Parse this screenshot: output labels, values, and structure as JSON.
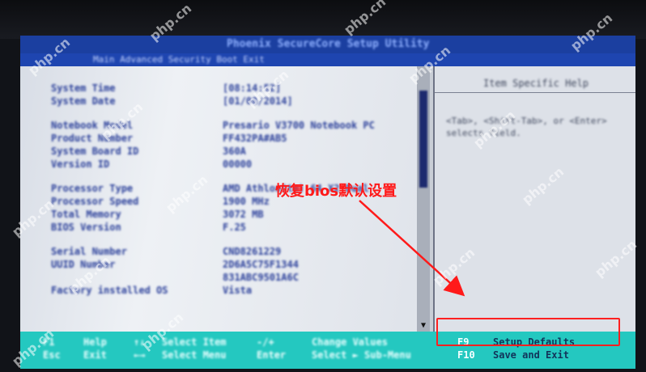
{
  "bios": {
    "title": "Phoenix SecureCore Setup Utility",
    "menu": "Main   Advanced   Security   Boot   Exit",
    "rows": [
      {
        "label": "System Time",
        "value": "[08:14:52]"
      },
      {
        "label": "System Date",
        "value": "[01/08/2014]"
      },
      {
        "label": "",
        "value": ""
      },
      {
        "label": "Notebook Model",
        "value": "Presario V3700 Notebook PC"
      },
      {
        "label": "Product Number",
        "value": "FF432PA#AB5"
      },
      {
        "label": "System Board ID",
        "value": "360A"
      },
      {
        "label": "Version ID",
        "value": "00000"
      },
      {
        "label": "",
        "value": ""
      },
      {
        "label": "Processor Type",
        "value": "AMD Athlon(tm) 64 X2 Dual"
      },
      {
        "label": "Processor Speed",
        "value": "1900 MHz"
      },
      {
        "label": "Total Memory",
        "value": "3072 MB"
      },
      {
        "label": "BIOS Version",
        "value": "F.25"
      },
      {
        "label": "",
        "value": ""
      },
      {
        "label": "Serial Number",
        "value": "CND8261229"
      },
      {
        "label": "UUID Number",
        "value": "2D6A5C75F1344"
      },
      {
        "label": "",
        "value": "831ABC9501A6C"
      },
      {
        "label": "Factory installed OS",
        "value": "Vista"
      }
    ],
    "help_title": "Item Specific Help",
    "help_text": "<Tab>, <Shift-Tab>, or <Enter> selects field.",
    "footer": {
      "row1": {
        "k1": "F1",
        "d1": "Help",
        "k2": "↑↓",
        "d2": "Select Item",
        "k3": "-/+",
        "d3": "Change Values",
        "k4": "F9",
        "d4": "Setup Defaults"
      },
      "row2": {
        "k1": "Esc",
        "d1": "Exit",
        "k2": "←→",
        "d2": "Select Menu",
        "k3": "Enter",
        "d3": "Select ► Sub-Menu",
        "k4": "F10",
        "d4": "Save and Exit"
      }
    },
    "scroll_arrow": "▼"
  },
  "annotation": {
    "text": "恢复bios默认设置",
    "color": "#ff1a1a"
  },
  "watermark": "php.cn"
}
